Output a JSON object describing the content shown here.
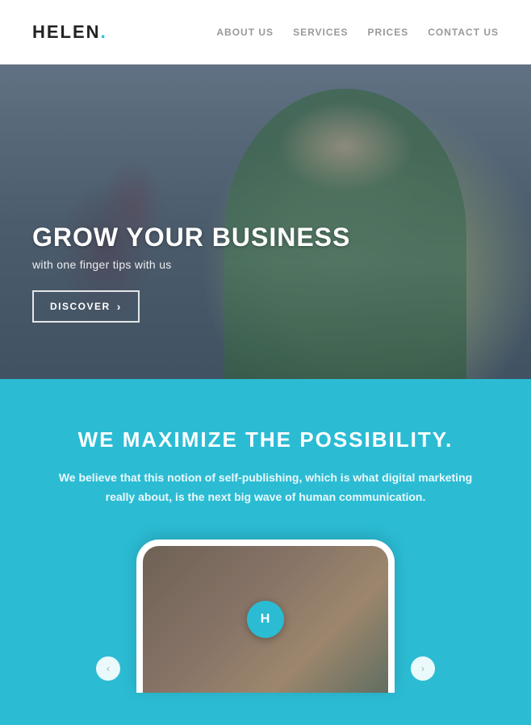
{
  "header": {
    "logo_text": "HELEN",
    "logo_dot": ".",
    "nav": {
      "items": [
        {
          "id": "about",
          "label": "ABOUT US"
        },
        {
          "id": "services",
          "label": "SERVICES"
        },
        {
          "id": "prices",
          "label": "PRICES"
        },
        {
          "id": "contact",
          "label": "CONTACT US"
        }
      ]
    }
  },
  "hero": {
    "title": "GROW YOUR BUSINESS",
    "subtitle": "with one finger tips with us",
    "button_label": "DISCOVER",
    "button_arrow": "›"
  },
  "blue_section": {
    "title": "WE MAXIMIZE THE POSSIBILITY.",
    "description": "We believe that this notion of self-publishing, which is what digital marketing really about, is the next big wave of human communication.",
    "phone_label": "H"
  }
}
